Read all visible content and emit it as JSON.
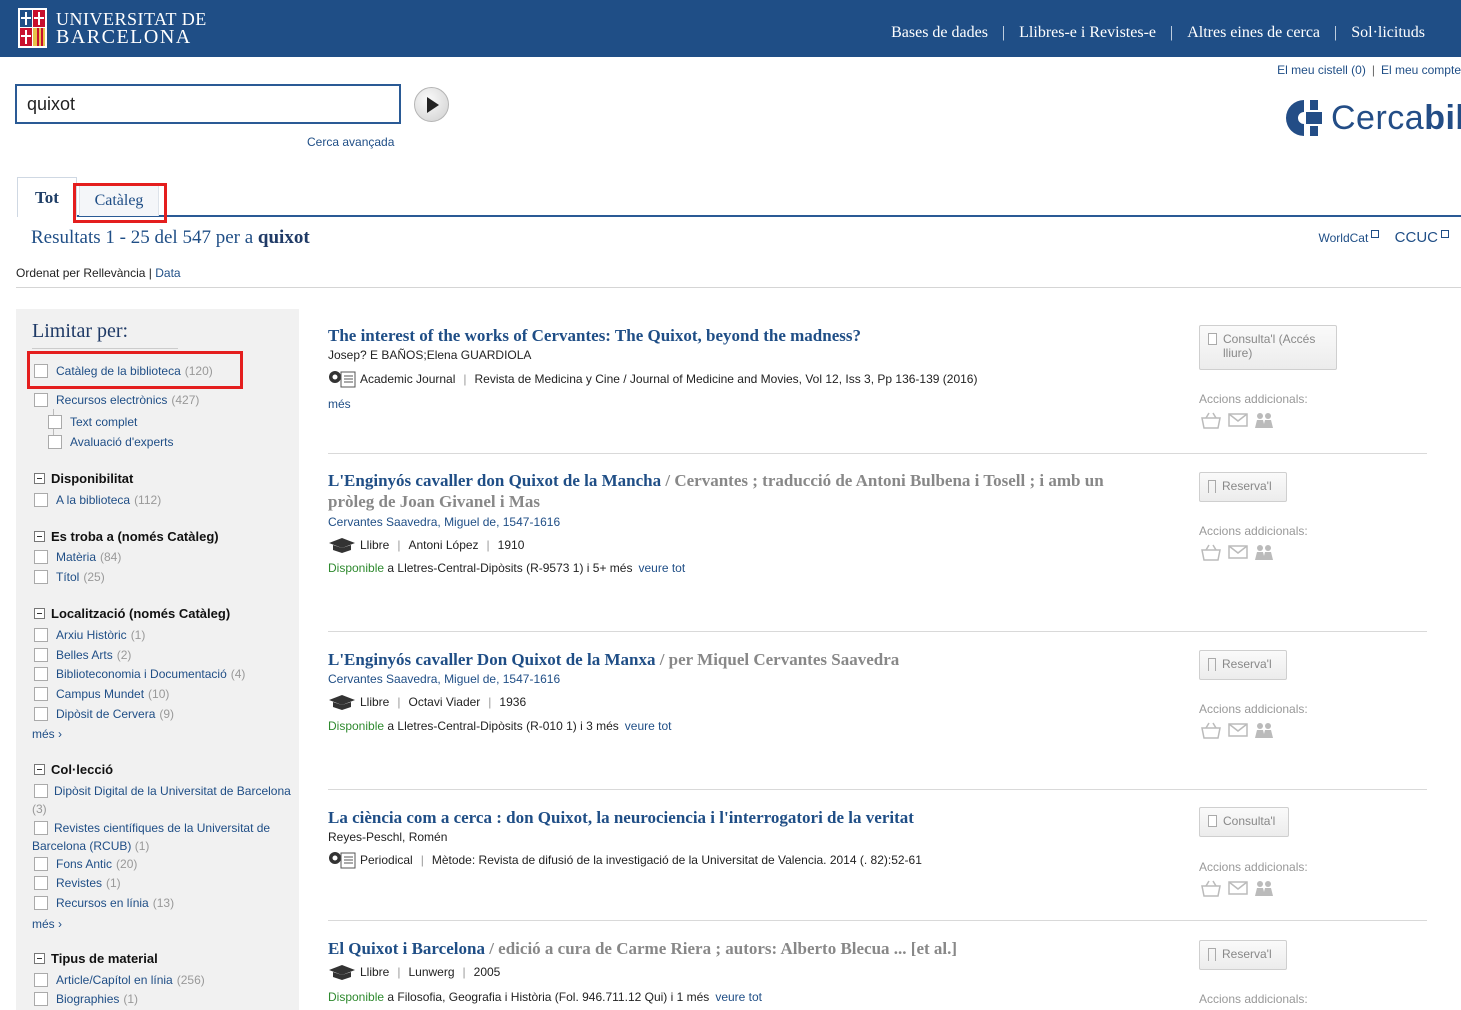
{
  "header": {
    "logo_line1": "UNIVERSITAT DE",
    "logo_line2": "BARCELONA",
    "nav": [
      "Bases de dades",
      "Llibres-e i Revistes-e",
      "Altres eines de cerca",
      "Sol·licituds"
    ],
    "separator": "|"
  },
  "account": {
    "cart": "El meu cistell (0)",
    "account": "El meu compte"
  },
  "search": {
    "value": "quixot",
    "advanced": "Cerca avançada"
  },
  "brand": {
    "name_light": "Cerca",
    "name_bold": "bib"
  },
  "tabs": {
    "all": "Tot",
    "catalog": "Catàleg"
  },
  "results_header": {
    "prefix": "Resultats 1 - 25 del 547 per a ",
    "query": "quixot",
    "worldcat": "WorldCat",
    "ccuc": "CCUC"
  },
  "sort": {
    "label": "Ordenat per",
    "relevance": "Rellevància",
    "sep": "|",
    "date": "Data"
  },
  "sidebar": {
    "title": "Limitar per:",
    "top_filters": [
      {
        "label": "Catàleg de la biblioteca",
        "count": "(120)"
      },
      {
        "label": "Recursos electrònics",
        "count": "(427)"
      }
    ],
    "sub_filters": [
      "Text complet",
      "Avaluació d'experts"
    ],
    "sections": {
      "disponibilitat": {
        "title": "Disponibilitat",
        "items": [
          {
            "label": "A la biblioteca",
            "count": "(112)"
          }
        ]
      },
      "es_troba": {
        "title": "Es troba a (només Catàleg)",
        "items": [
          {
            "label": "Matèria",
            "count": "(84)"
          },
          {
            "label": "Títol",
            "count": "(25)"
          }
        ]
      },
      "localitzacio": {
        "title": "Localització (només Catàleg)",
        "items": [
          {
            "label": "Arxiu Històric",
            "count": "(1)"
          },
          {
            "label": "Belles Arts",
            "count": "(2)"
          },
          {
            "label": "Biblioteconomia i Documentació",
            "count": "(4)"
          },
          {
            "label": "Campus Mundet",
            "count": "(10)"
          },
          {
            "label": "Dipòsit de Cervera",
            "count": "(9)"
          }
        ],
        "more": "més ›"
      },
      "colleccio": {
        "title": "Col·lecció",
        "wrapped": [
          {
            "label_a": "Dipòsit Digital de la Universitat de",
            "label_b": "Barcelona",
            "count": "(3)"
          },
          {
            "label_a": "Revistes científiques de la Universitat de",
            "label_b": "Barcelona (RCUB)",
            "count": "(1)"
          }
        ],
        "items": [
          {
            "label": "Fons Antic",
            "count": "(20)"
          },
          {
            "label": "Revistes",
            "count": "(1)"
          },
          {
            "label": "Recursos en línia",
            "count": "(13)"
          }
        ],
        "more": "més ›"
      },
      "tipus": {
        "title": "Tipus de material",
        "items": [
          {
            "label": "Article/Capítol en línia",
            "count": "(256)"
          },
          {
            "label": "Biographies",
            "count": "(1)"
          }
        ]
      }
    }
  },
  "results": [
    {
      "title": "The interest of the works of Cervantes: The Quixot, beyond the madness?",
      "title_rest": "",
      "author": "Josep? E BAÑOS;Elena GUARDIOLA",
      "type": "Academic Journal",
      "meta": [
        "Revista de Medicina y Cine / Journal of Medicine and Movies, Vol 12, Iss 3, Pp 136-139 (2016)"
      ],
      "more": "més",
      "action": "Consulta'l (Accés lliure)",
      "additional": "Accions addicionals:"
    },
    {
      "title": "L'Enginyós cavaller don Quixot de la Mancha",
      "title_rest": " / Cervantes ; traducció de Antoni Bulbena i Tosell ; i amb un pròleg de Joan Givanel i Mas",
      "author": "Cervantes Saavedra, Miguel de, 1547-1616",
      "type": "Llibre",
      "meta": [
        "Antoni López",
        "1910"
      ],
      "avail_label": "Disponible",
      "avail_text": " a Lletres-Central-Dipòsits (R-9573 1) i 5+ més",
      "avail_link": "veure tot",
      "action": "Reserva'l",
      "additional": "Accions addicionals:"
    },
    {
      "title": "L'Enginyós cavaller Don Quixot de la Manxa",
      "title_rest": " / per Miquel Cervantes Saavedra",
      "author": "Cervantes Saavedra, Miguel de, 1547-1616",
      "type": "Llibre",
      "meta": [
        "Octavi Viader",
        "1936"
      ],
      "avail_label": "Disponible",
      "avail_text": " a Lletres-Central-Dipòsits (R-010 1) i 3 més",
      "avail_link": "veure tot",
      "action": "Reserva'l",
      "additional": "Accions addicionals:"
    },
    {
      "title": "La ciència com a cerca : don Quixot, la neurociencia i l'interrogatori de la veritat",
      "title_rest": "",
      "author": "Reyes-Peschl, Romén",
      "type": "Periodical",
      "meta": [
        "Mètode: Revista de difusió de la investigació de la Universitat de Valencia. 2014 (. 82):52-61"
      ],
      "action": "Consulta'l",
      "additional": "Accions addicionals:"
    },
    {
      "title": "El Quixot i Barcelona",
      "title_rest": " / edició a cura de Carme Riera ; autors: Alberto Blecua ... [et al.]",
      "type": "Llibre",
      "meta": [
        "Lunwerg",
        "2005"
      ],
      "avail_label": "Disponible",
      "avail_text": " a Filosofia, Geografia i Història (Fol. 946.711.12 Qui) i 1 més",
      "avail_link": "veure tot",
      "action": "Reserva'l",
      "additional": "Accions addicionals:"
    }
  ],
  "colors": {
    "header_bg": "#1f4e86",
    "link": "#1f4e86",
    "available": "#2f8a2f",
    "highlight": "#e41e1e"
  }
}
